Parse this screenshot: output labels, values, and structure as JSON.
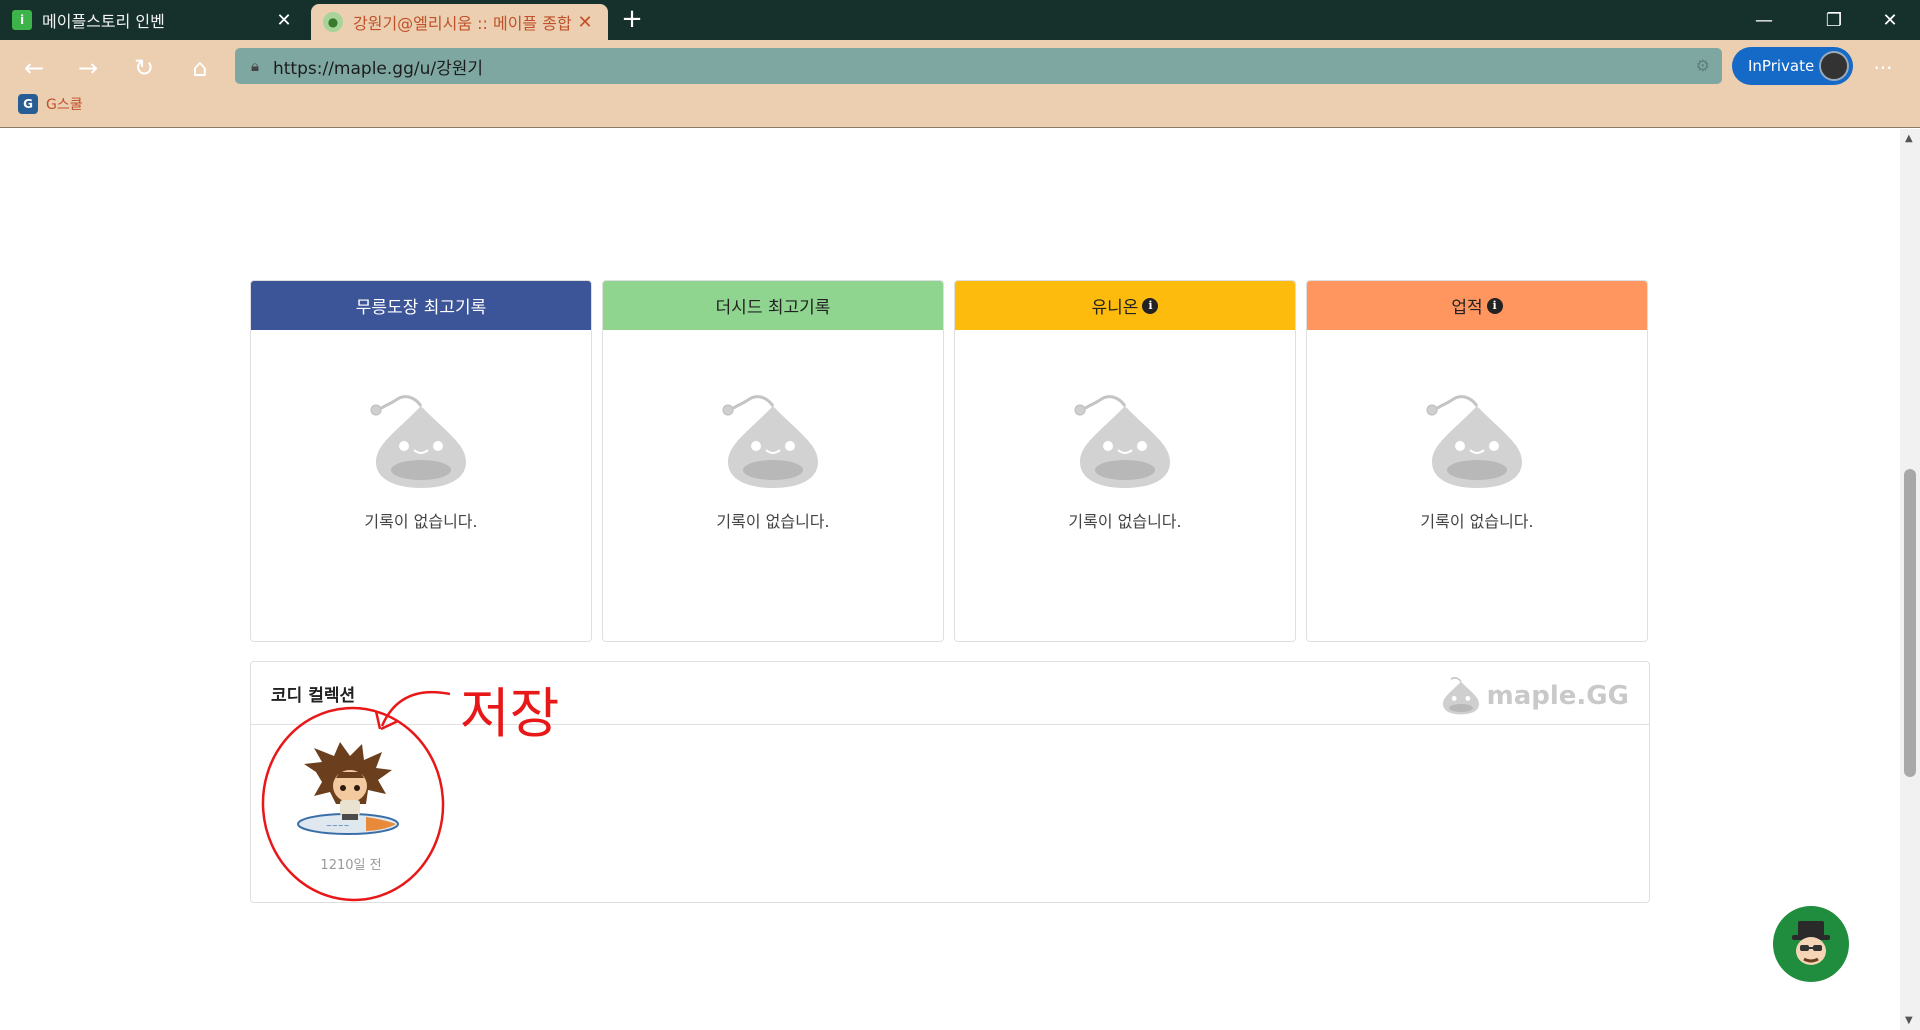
{
  "browser": {
    "tabs": [
      {
        "title": "메이플스토리 인벤",
        "favicon": "i",
        "active": false
      },
      {
        "title": "강원기@엘리시움 :: 메이플 종합",
        "favicon": "",
        "active": true
      }
    ],
    "url": "https://maple.gg/u/강원기",
    "inprivate_label": "InPrivate",
    "bookmark": {
      "label": "G스쿨",
      "icon": "G"
    }
  },
  "cards": [
    {
      "title": "무릉도장 최고기록",
      "color": "#3c5599",
      "empty_text": "기록이 없습니다."
    },
    {
      "title": "더시드 최고기록",
      "color": "#8fd48f",
      "empty_text": "기록이 없습니다."
    },
    {
      "title": "유니온",
      "color": "#fdbb0e",
      "empty_text": "기록이 없습니다."
    },
    {
      "title": "업적",
      "color": "#ff965f",
      "empty_text": "기록이 없습니다."
    }
  ],
  "codi": {
    "title": "코디 컬렉션",
    "logo": "maple.GG",
    "items": [
      {
        "date": "1210일 전"
      }
    ]
  },
  "annotation": {
    "text": "저장",
    "color": "#e81818"
  }
}
